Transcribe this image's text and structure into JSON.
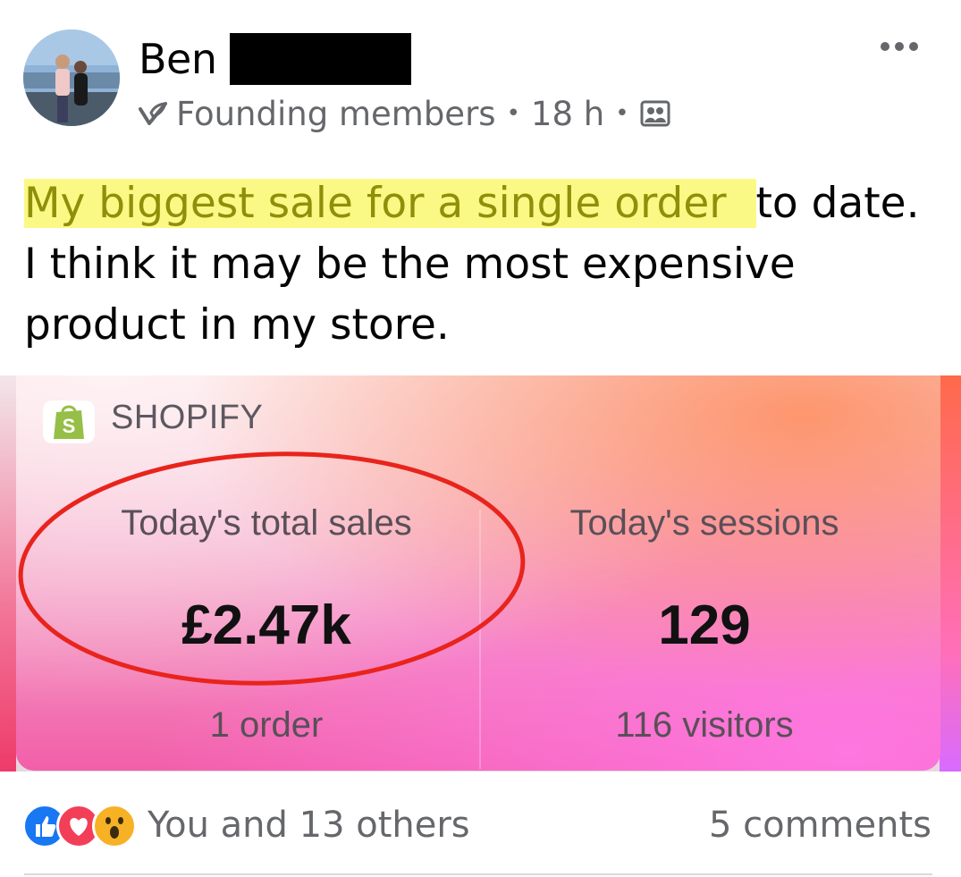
{
  "post": {
    "author_first_name": "Ben",
    "author_surname_redacted": true,
    "group_badge_label": "Founding members",
    "separator": "•",
    "timestamp": "18 h",
    "audience_icon": "group-photo-icon",
    "more_icon": "more-options-icon",
    "text_highlighted": "My biggest sale for a single order ",
    "text_rest": "to date. I think it may be the most expensive product in my store."
  },
  "shopify_widget": {
    "brand_name": "SHOPIFY",
    "logo_letter": "S",
    "left_label": "Today's total sales",
    "left_value": "£2.47k",
    "left_sub": "1 order",
    "right_label": "Today's sessions",
    "right_value": "129",
    "right_sub": "116 visitors",
    "annotation_color": "#e8241c"
  },
  "footer": {
    "reaction_icons": [
      "like-icon",
      "love-icon",
      "wow-icon"
    ],
    "reactions_text": "You and 13 others",
    "comments_text": "5 comments"
  },
  "colors": {
    "highlight_bg": "#fbf985",
    "highlight_text": "#8f8f0a",
    "meta_gray": "#65676b",
    "like_blue": "#1877f2",
    "love_red": "#f33e58",
    "wow_yellow": "#f7b125",
    "shopify_green": "#95bf47"
  }
}
